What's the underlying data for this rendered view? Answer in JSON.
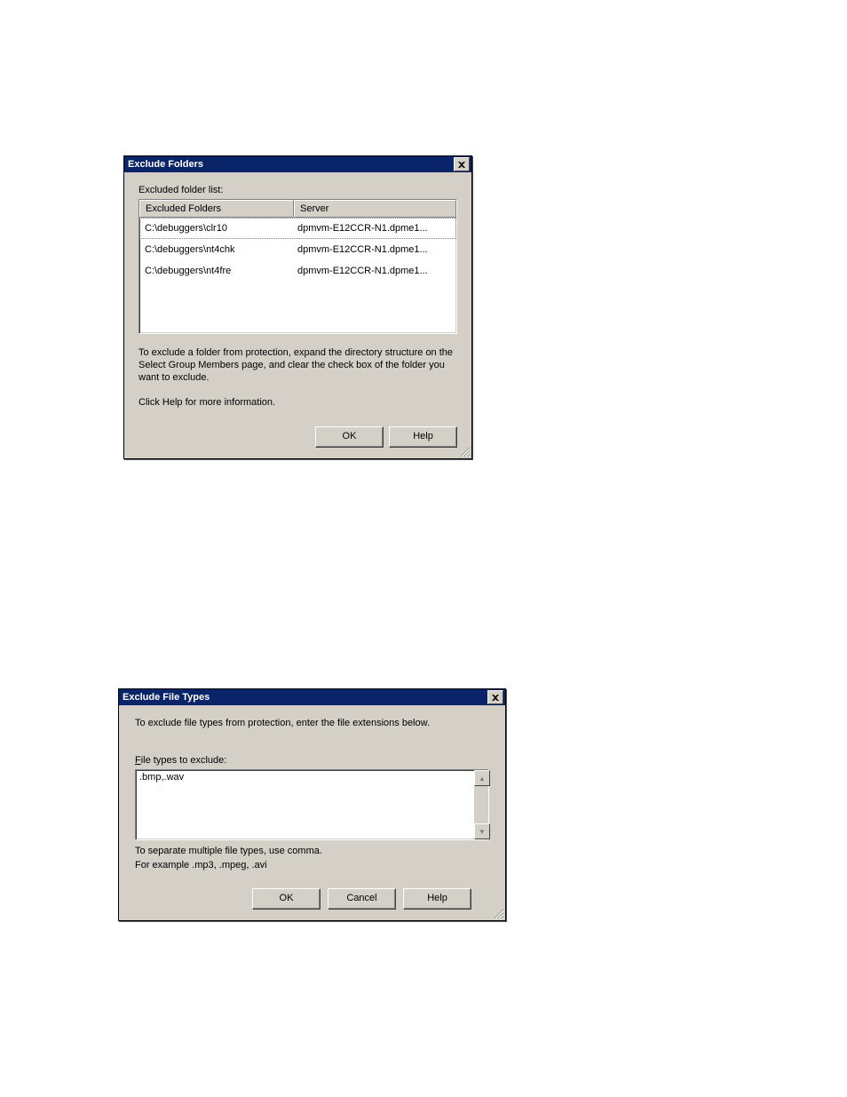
{
  "dialog1": {
    "title": "Exclude Folders",
    "list_label": "Excluded folder list:",
    "columns": {
      "folders": "Excluded Folders",
      "server": "Server"
    },
    "rows": [
      {
        "folder": "C:\\debuggers\\clr10",
        "server": "dpmvm-E12CCR-N1.dpme1..."
      },
      {
        "folder": "C:\\debuggers\\nt4chk",
        "server": "dpmvm-E12CCR-N1.dpme1..."
      },
      {
        "folder": "C:\\debuggers\\nt4fre",
        "server": "dpmvm-E12CCR-N1.dpme1..."
      }
    ],
    "instruction1": "To exclude a folder from protection, expand the directory structure on the Select Group Members page, and clear the check box of the folder you want to exclude.",
    "instruction2": "Click Help for more information.",
    "buttons": {
      "ok": "OK",
      "help": "Help"
    }
  },
  "dialog2": {
    "title": "Exclude File Types",
    "intro": "To exclude file types from protection, enter the file extensions below.",
    "field_label_prefix": "F",
    "field_label_rest": "ile types to exclude:",
    "value": ".bmp,.wav",
    "hint1": "To separate multiple file types, use comma.",
    "hint2": "For example .mp3, .mpeg, .avi",
    "buttons": {
      "ok": "OK",
      "cancel": "Cancel",
      "help": "Help"
    }
  }
}
